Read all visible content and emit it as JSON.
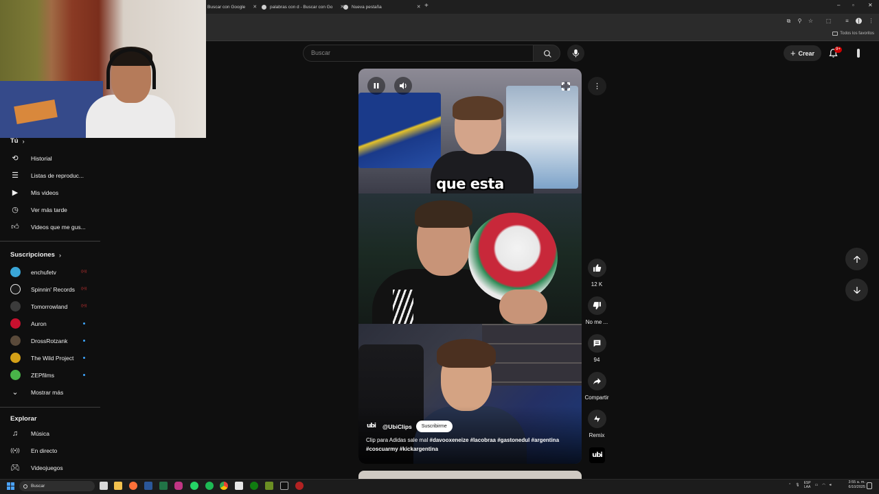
{
  "browser": {
    "tabs": [
      {
        "label": "Buscar con Google"
      },
      {
        "label": "palabras con d - Buscar con Go"
      },
      {
        "label": "Nueva pestaña"
      }
    ],
    "bookmarks_label": "Todos los favoritos"
  },
  "header": {
    "search_placeholder": "Buscar",
    "create_label": "Crear",
    "notifications_badge": "9+"
  },
  "sidebar": {
    "you": {
      "title": "Tú",
      "items": [
        {
          "label": "Historial",
          "icon": "history-icon"
        },
        {
          "label": "Listas de reproduc...",
          "icon": "playlists-icon"
        },
        {
          "label": "Mis videos",
          "icon": "my-videos-icon"
        },
        {
          "label": "Ver más tarde",
          "icon": "watch-later-icon"
        },
        {
          "label": "Videos que me gus...",
          "icon": "liked-videos-icon"
        }
      ]
    },
    "subscriptions": {
      "title": "Suscripciones",
      "items": [
        {
          "label": "enchufetv",
          "avatar_color": "#3aa6d8",
          "status": "live"
        },
        {
          "label": "Spinnin' Records",
          "avatar_color": "#1a1a1a",
          "status": "live"
        },
        {
          "label": "Tomorrowland",
          "avatar_color": "#3b3b3b",
          "status": "live"
        },
        {
          "label": "Auron",
          "avatar_color": "#c8102e",
          "status": "new"
        },
        {
          "label": "DrossRotzank",
          "avatar_color": "#5a4a3a",
          "status": "new"
        },
        {
          "label": "The Wild Project",
          "avatar_color": "#d4a017",
          "status": "new"
        },
        {
          "label": "ZEPfilms",
          "avatar_color": "#49b449",
          "status": "new"
        }
      ],
      "show_more": "Mostrar más"
    },
    "explore": {
      "title": "Explorar",
      "items": [
        {
          "label": "Música",
          "icon": "music-icon"
        },
        {
          "label": "En directo",
          "icon": "live-icon"
        },
        {
          "label": "Videojuegos",
          "icon": "gaming-icon"
        }
      ]
    }
  },
  "short": {
    "caption": "que esta",
    "channel_handle": "@UbiClips",
    "channel_logo": "ubi",
    "subscribe_label": "Suscribirme",
    "description_plain": "Clip para Adidas sale mal ",
    "description_tags": "#davooxeneize #lacobraa #gastonedul #argentina #coscuarmy #kickargentina",
    "actions": {
      "likes": "12 K",
      "dislike_label": "No me ...",
      "comments": "94",
      "share_label": "Compartir",
      "remix_label": "Remix"
    }
  },
  "taskbar": {
    "search_label": "Buscar",
    "lang_line1": "ESP",
    "lang_line2": "LAA",
    "time": "3:55 a. m.",
    "date": "6/10/2025"
  },
  "colors": {
    "background": "#0f0f0f",
    "accent_red": "#cc0000",
    "new_dot": "#3ea6ff"
  }
}
